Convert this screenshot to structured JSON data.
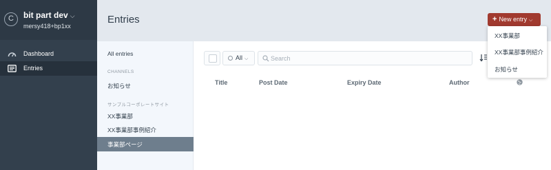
{
  "site": {
    "logo_letter": "C",
    "name": "bit part dev",
    "caret": "⌵",
    "user": "mersy418+bp1xx"
  },
  "nav": {
    "items": [
      {
        "label": "Dashboard",
        "icon": "dashboard-icon",
        "active": false
      },
      {
        "label": "Entries",
        "icon": "entries-icon",
        "active": true
      }
    ]
  },
  "header": {
    "title": "Entries",
    "new_entry_label": "New entry",
    "new_entry_plus": "+",
    "new_entry_caret": "⌵",
    "accent_color": "#a13a2f"
  },
  "new_entry_menu": {
    "items": [
      "XX事業部",
      "XX事業部事例紹介",
      "お知らせ"
    ]
  },
  "sources": {
    "all_entries": "All entries",
    "channels_heading": "CHANNELS",
    "channels": [
      "お知らせ"
    ],
    "group_heading": "サンプルコーポレートサイト",
    "group_items": [
      "XX事業部",
      "XX事業部事例紹介"
    ],
    "selected": "事業部ページ"
  },
  "toolbar": {
    "status_label": "All",
    "status_caret": "⌵",
    "search_placeholder": "Search",
    "search_value": ""
  },
  "table": {
    "columns": [
      "Title",
      "Post Date",
      "Expiry Date",
      "Author"
    ],
    "status_column_icon": "globe-icon",
    "rows": []
  }
}
